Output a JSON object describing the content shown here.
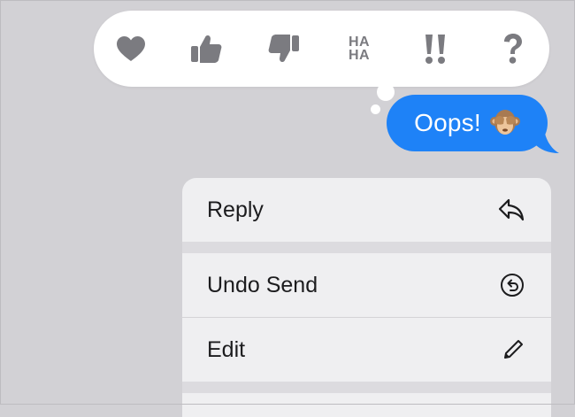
{
  "tapback": {
    "reactions": [
      {
        "name": "heart",
        "label": ""
      },
      {
        "name": "thumbs-up",
        "label": ""
      },
      {
        "name": "thumbs-down",
        "label": ""
      },
      {
        "name": "haha",
        "label_top": "HA",
        "label_bottom": "HA"
      },
      {
        "name": "exclamation",
        "label": "!!"
      },
      {
        "name": "question",
        "label": "?"
      }
    ]
  },
  "message": {
    "text": "Oops!",
    "emoji": "see-no-evil-monkey",
    "bubble_color": "#1e82f7"
  },
  "menu": {
    "items": [
      {
        "label": "Reply",
        "icon": "reply-arrow-icon"
      },
      {
        "label": "Undo Send",
        "icon": "undo-circle-icon"
      },
      {
        "label": "Edit",
        "icon": "pencil-icon"
      }
    ]
  },
  "colors": {
    "background": "#d2d1d5",
    "icon_gray": "#7b7b80",
    "menu_bg": "#efeff1"
  }
}
